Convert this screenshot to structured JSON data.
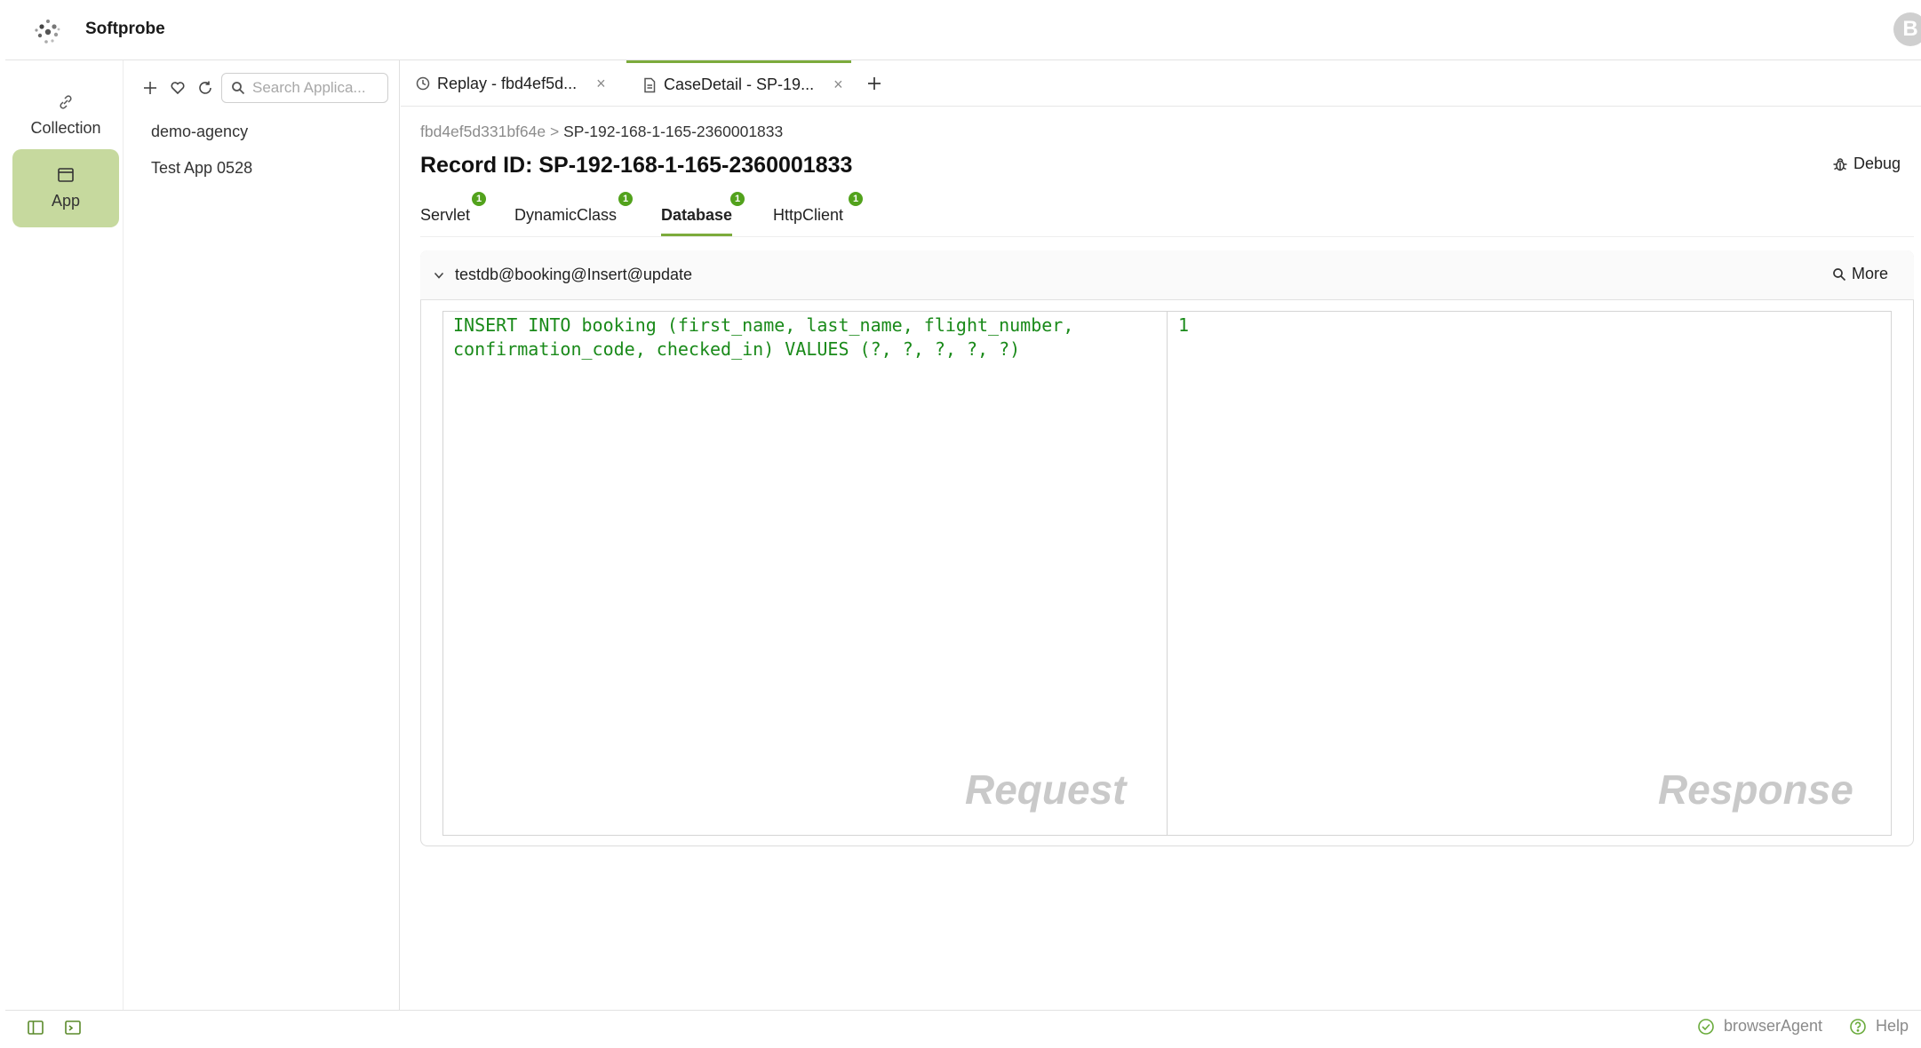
{
  "app": {
    "title": "Softprobe",
    "avatar_letter": "B"
  },
  "rail": {
    "items": [
      {
        "label": "Collection",
        "icon": "link-icon"
      },
      {
        "label": "App",
        "icon": "window-icon"
      }
    ]
  },
  "apps_panel": {
    "search_placeholder": "Search Applica...",
    "items": [
      "demo-agency",
      "Test App 0528"
    ]
  },
  "tabs": [
    {
      "label": "Replay - fbd4ef5d...",
      "icon": "clock-icon"
    },
    {
      "label": "CaseDetail - SP-19...",
      "icon": "document-icon"
    }
  ],
  "content": {
    "breadcrumb": {
      "parent": "fbd4ef5d331bf64e",
      "separator": ">",
      "current": "SP-192-168-1-165-2360001833"
    },
    "record_title": "Record ID: SP-192-168-1-165-2360001833",
    "debug_label": "Debug",
    "subtabs": [
      {
        "label": "Servlet",
        "count": "1"
      },
      {
        "label": "DynamicClass",
        "count": "1"
      },
      {
        "label": "Database",
        "count": "1"
      },
      {
        "label": "HttpClient",
        "count": "1"
      }
    ],
    "active_subtab": "Database",
    "operation": "testdb@booking@Insert@update",
    "more_label": "More",
    "request_code": "INSERT INTO booking (first_name, last_name, flight_number,\nconfirmation_code, checked_in) VALUES (?, ?, ?, ?, ?)",
    "response_code": "1",
    "request_watermark": "Request",
    "response_watermark": "Response"
  },
  "status": {
    "agent_label": "browserAgent",
    "help_label": "Help"
  },
  "colors": {
    "accent": "#7cab3c",
    "active_rail": "#c6d99e",
    "badge": "#52a21c",
    "code": "#1a8a1a"
  }
}
